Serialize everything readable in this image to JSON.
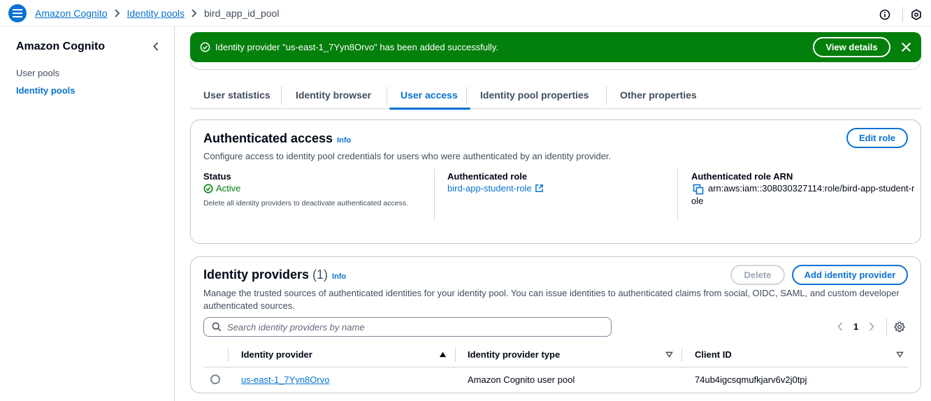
{
  "topbar": {
    "breadcrumbs": [
      "Amazon Cognito",
      "Identity pools",
      "bird_app_id_pool"
    ],
    "icons": [
      "menu-icon",
      "info-circle-icon",
      "hexagon-settings-icon"
    ]
  },
  "sidenav": {
    "title": "Amazon Cognito",
    "items": [
      {
        "label": "User pools",
        "active": false
      },
      {
        "label": "Identity pools",
        "active": true
      }
    ]
  },
  "flash": {
    "message": "Identity provider \"us-east-1_7Yyn8Orvo\" has been added successfully.",
    "button": "View details",
    "color": "#037f0c"
  },
  "tabs": [
    "User statistics",
    "Identity browser",
    "User access",
    "Identity pool properties",
    "Other properties"
  ],
  "active_tab": "User access",
  "auth_access": {
    "title": "Authenticated access",
    "info": "Info",
    "description": "Configure access to identity pool credentials for users who were authenticated by an identity provider.",
    "edit_button": "Edit role",
    "status_label": "Status",
    "status_value": "Active",
    "status_note": "Delete all identity providers to deactivate authenticated access.",
    "role_label": "Authenticated role",
    "role_value": "bird-app-student-role",
    "arn_label": "Authenticated role ARN",
    "arn_value": "arn:aws:iam::308030327114:role/bird-app-student-role"
  },
  "providers": {
    "title": "Identity providers",
    "count": "(1)",
    "info": "Info",
    "delete_button": "Delete",
    "add_button": "Add identity provider",
    "description": "Manage the trusted sources of authenticated identities for your identity pool. You can issue identities to authenticated claims from social, OIDC, SAML, and custom developer authenticated sources.",
    "search_placeholder": "Search identity providers by name",
    "page": "1",
    "columns": [
      "Identity provider",
      "Identity provider type",
      "Client ID"
    ],
    "rows": [
      {
        "provider": "us-east-1_7Yyn8Orvo",
        "type": "Amazon Cognito user pool",
        "client_id": "74ub4igcsqmufkjarv6v2j0tpj"
      }
    ]
  },
  "colors": {
    "accent": "#0972d3",
    "success": "#037f0c",
    "text": "#000716",
    "muted": "#414d5c"
  }
}
